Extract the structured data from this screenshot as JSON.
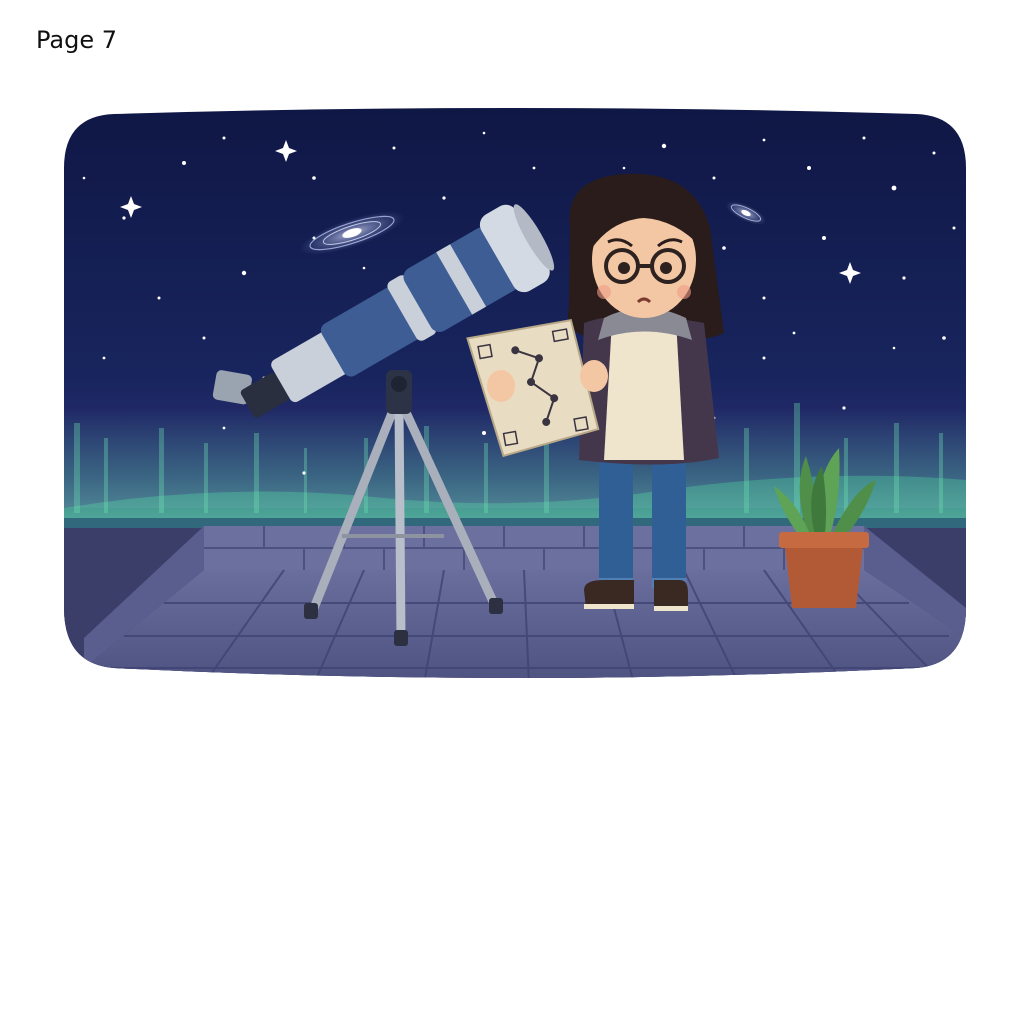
{
  "page": {
    "label": "Page 7"
  },
  "illustration": {
    "elements": [
      "night-sky",
      "stars",
      "spiral-galaxies",
      "aurora",
      "telescope",
      "tripod",
      "girl-with-glasses",
      "star-chart",
      "potted-plant",
      "rooftop-tiles"
    ],
    "colors": {
      "sky_top": "#101a48",
      "sky_bottom": "#1f2d6a",
      "aurora": "#4fd6a0",
      "telescope_blue": "#3d5d94",
      "telescope_silver": "#c9d0da",
      "roof": "#5e6290",
      "pot": "#b25a35",
      "plant": "#4f8f4a",
      "jacket": "#45374b",
      "jeans": "#2f5f95",
      "sweater": "#efe4cc",
      "paper": "#e8dcc2"
    }
  }
}
